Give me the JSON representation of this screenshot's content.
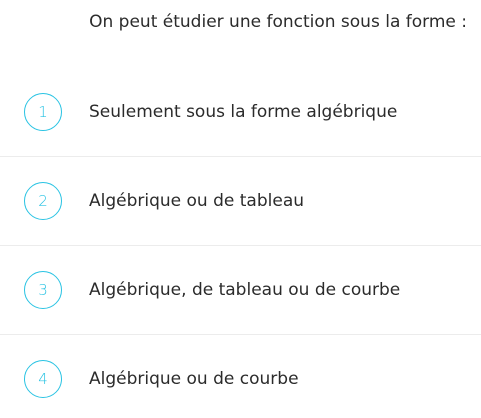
{
  "question": "On peut étudier une fonction sous la forme :",
  "accent_color": "#29c3e3",
  "options": [
    {
      "number": "1",
      "label": "Seulement sous la forme algébrique"
    },
    {
      "number": "2",
      "label": "Algébrique ou de tableau"
    },
    {
      "number": "3",
      "label": "Algébrique, de tableau ou de courbe"
    },
    {
      "number": "4",
      "label": "Algébrique ou de courbe"
    }
  ]
}
